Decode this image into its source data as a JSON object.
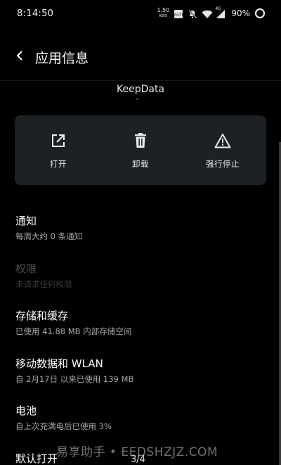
{
  "status_bar": {
    "time": "8:14:50",
    "net_speed_value": "1.50",
    "net_speed_unit": "KB/S",
    "network_type": "4G",
    "battery_percent": "90%"
  },
  "header": {
    "title": "应用信息"
  },
  "app": {
    "name": "KeepData"
  },
  "actions": [
    {
      "label": "打开",
      "icon": "open-external-icon"
    },
    {
      "label": "卸载",
      "icon": "trash-icon"
    },
    {
      "label": "强行停止",
      "icon": "warning-icon"
    }
  ],
  "settings": [
    {
      "title": "通知",
      "subtitle": "每周大约 0 条通知",
      "enabled": true
    },
    {
      "title": "权限",
      "subtitle": "未请求任何权限",
      "enabled": false
    },
    {
      "title": "存储和缓存",
      "subtitle": "已使用 41.88 MB 内部存储空间",
      "enabled": true
    },
    {
      "title": "移动数据和 WLAN",
      "subtitle": "自 2月17日 以来已使用 139 MB",
      "enabled": true
    },
    {
      "title": "电池",
      "subtitle": "自上次充满电后已使用 3%",
      "enabled": true
    },
    {
      "title": "默认打开",
      "subtitle": "",
      "enabled": true
    }
  ],
  "page_indicator": "3/4",
  "watermark": "易享助手 • EEDSHZJZ.COM",
  "colors": {
    "background": "#000000",
    "card": "#1d2124",
    "primary_text": "#ffffff",
    "secondary_text": "#a6a6a6",
    "disabled_text": "#4c4c4c"
  }
}
